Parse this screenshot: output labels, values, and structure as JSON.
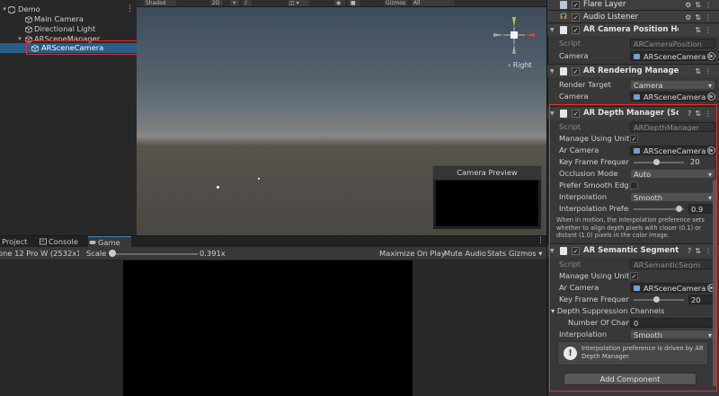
{
  "scene_toolbar": {
    "shading_mode": "Shaded",
    "mode_2d": "2D",
    "gizmos_label": "Gizmos",
    "search_placeholder": "All"
  },
  "hierarchy": {
    "items": [
      {
        "label": "Demo"
      },
      {
        "label": "Main Camera"
      },
      {
        "label": "Directional Light"
      },
      {
        "label": "ARSceneManager"
      },
      {
        "label": "ARSceneCamera"
      }
    ]
  },
  "scene_view": {
    "gizmo_label": "Right",
    "camera_preview_title": "Camera Preview"
  },
  "bottom_tabs": [
    {
      "label": "Project"
    },
    {
      "label": "Console"
    },
    {
      "label": "Game"
    }
  ],
  "game_toolbar": {
    "resolution": "one 12 Pro W (2532x11",
    "scale_label": "Scale",
    "scale_value": "0.391x",
    "scale_fraction": 0.03,
    "maximize": "Maximize On Play",
    "mute": "Mute Audio",
    "stats": "Stats",
    "gizmos": "Gizmos"
  },
  "inspector": {
    "flare_layer": "Flare Layer",
    "audio_listener": "Audio Listener",
    "ar_camera_position_helper": {
      "title": "AR Camera Position Helper",
      "script_label": "Script",
      "script_value": "ARCameraPosition",
      "camera_label": "Camera",
      "camera_value": "ARSceneCamera ("
    },
    "ar_rendering_manager": {
      "title": "AR Rendering Manager (Sc",
      "render_target_label": "Render Target",
      "render_target_value": "Camera",
      "camera_label": "Camera",
      "camera_value": "ARSceneCamera ("
    },
    "ar_depth_manager": {
      "title": "AR Depth Manager (Script",
      "script_label": "Script",
      "script_value": "ARDepthManager",
      "manage_unity_label": "Manage Using Unity I",
      "ar_camera_label": "Ar Camera",
      "ar_camera_value": "ARSceneCamera (",
      "key_frame_label": "Key Frame Frequency",
      "key_frame_value": "20",
      "key_frame_fraction": 0.45,
      "occlusion_label": "Occlusion Mode",
      "occlusion_value": "Auto",
      "prefer_smooth_label": "Prefer Smooth Edges",
      "interpolation_label": "Interpolation",
      "interpolation_value": "Smooth",
      "interp_pref_label": "Interpolation Preferer",
      "interp_pref_value": "0.9",
      "interp_pref_fraction": 0.9,
      "help_text": "When in motion, the interpolation preference sets whether to align depth pixels with closer (0.1) or distant (1.0) pixels in the color image."
    },
    "ar_semantic_segmentation": {
      "title": "AR Semantic Segmentatio",
      "script_label": "Script",
      "script_value": "ARSemanticSegm",
      "manage_unity_label": "Manage Using Unity I",
      "ar_camera_label": "Ar Camera",
      "ar_camera_value": "ARSceneCamera (",
      "key_frame_label": "Key Frame Frequency",
      "key_frame_value": "20",
      "key_frame_fraction": 0.45,
      "depth_suppression_label": "Depth Suppression Channels",
      "number_channels_label": "Number Of Channe",
      "number_channels_value": "0",
      "interpolation_label": "Interpolation",
      "interpolation_value": "Smooth",
      "info_text": "Interpolation preference is driven by AR Depth Manager."
    },
    "add_component": "Add Component"
  },
  "colors": {
    "highlight_red": "#e0302e",
    "accent_blue": "#4a82c4"
  }
}
